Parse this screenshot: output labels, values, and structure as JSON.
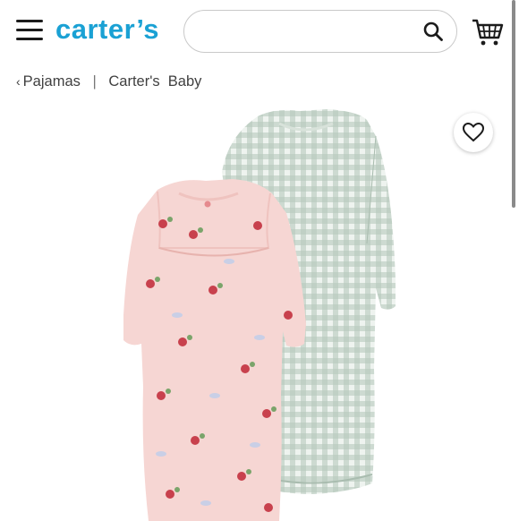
{
  "header": {
    "brand": "carter’s",
    "search": {
      "value": "",
      "placeholder": ""
    },
    "menu_icon": "hamburger-menu-icon",
    "search_icon": "magnifier-icon",
    "cart_icon": "shopping-cart-icon"
  },
  "breadcrumb": {
    "items": [
      {
        "label": "Pajamas"
      },
      {
        "label": "Carter's  Baby"
      }
    ]
  },
  "product": {
    "image": "product-photo-two-baby-sleeper-gowns",
    "favorite_icon": "heart-icon"
  },
  "colors": {
    "brand": "#1aa1d4",
    "pink_gown": "#f6d6d3",
    "green_gingham": "#b7c9bd"
  }
}
